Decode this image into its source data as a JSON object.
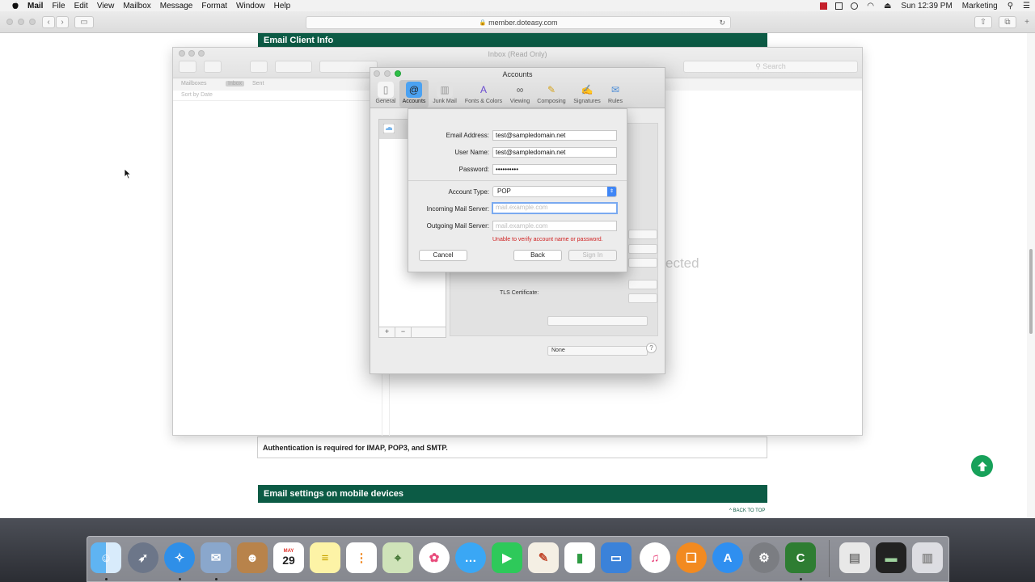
{
  "menubar": {
    "app": "Mail",
    "items": [
      "File",
      "Edit",
      "View",
      "Mailbox",
      "Message",
      "Format",
      "Window",
      "Help"
    ],
    "clock": "Sun 12:39 PM",
    "user": "Marketing"
  },
  "safari": {
    "url": "member.doteasy.com"
  },
  "webpage": {
    "section1_title": "Email Client Info",
    "auth_note": "Authentication is required for IMAP, POP3, and SMTP.",
    "section2_title": "Email settings on mobile devices",
    "back_to_top": "^ BACK TO TOP"
  },
  "mail": {
    "title": "Inbox (Read Only)",
    "search_placeholder": "Search",
    "favorites": [
      "Mailboxes",
      "Inbox",
      "Sent"
    ],
    "sort_label": "Sort by Date",
    "no_message_fragment": "ected"
  },
  "accounts": {
    "title": "Accounts",
    "tabs": [
      {
        "label": "General",
        "icon": "switch-icon"
      },
      {
        "label": "Accounts",
        "icon": "at-icon"
      },
      {
        "label": "Junk Mail",
        "icon": "trash-can-icon"
      },
      {
        "label": "Fonts & Colors",
        "icon": "fonts-icon"
      },
      {
        "label": "Viewing",
        "icon": "glasses-icon"
      },
      {
        "label": "Composing",
        "icon": "pencil-icon"
      },
      {
        "label": "Signatures",
        "icon": "signature-icon"
      },
      {
        "label": "Rules",
        "icon": "rules-icon"
      }
    ],
    "tls_label": "TLS Certificate:",
    "tls_value": "None",
    "add": "+",
    "remove": "−",
    "help": "?"
  },
  "sheet": {
    "email_label": "Email Address:",
    "email_value": "test@sampledomain.net",
    "username_label": "User Name:",
    "username_value": "test@sampledomain.net",
    "password_label": "Password:",
    "password_value": "••••••••••",
    "account_type_label": "Account Type:",
    "account_type_value": "POP",
    "incoming_label": "Incoming Mail Server:",
    "incoming_placeholder": "mail.example.com",
    "outgoing_label": "Outgoing Mail Server:",
    "outgoing_placeholder": "mail.example.com",
    "error": "Unable to verify account name or password.",
    "cancel": "Cancel",
    "back": "Back",
    "sign_in": "Sign In"
  },
  "dock": {
    "calendar_month": "MAY",
    "calendar_day": "29"
  }
}
